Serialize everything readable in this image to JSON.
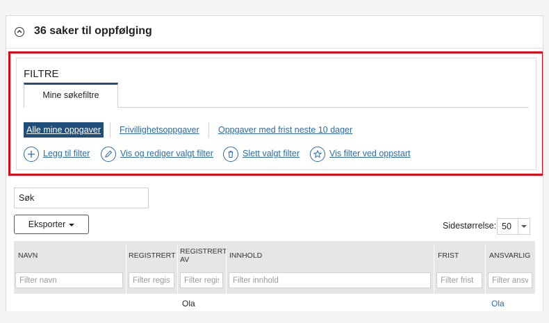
{
  "header": {
    "title": "36 saker til oppfølging"
  },
  "filters": {
    "heading": "FILTRE",
    "tab_label": "Mine søkefiltre",
    "quick_filters": [
      {
        "label": "Alle mine oppgaver",
        "active": true
      },
      {
        "label": "Frivillighetsoppgaver",
        "active": false
      },
      {
        "label": "Oppgaver med frist neste 10 dager",
        "active": false
      }
    ],
    "actions": [
      {
        "label": "Legg til filter",
        "icon": "plus-icon"
      },
      {
        "label": "Vis og rediger valgt filter",
        "icon": "pencil-icon"
      },
      {
        "label": "Slett valgt filter",
        "icon": "trash-icon"
      },
      {
        "label": "Vis filter ved oppstart",
        "icon": "star-icon"
      }
    ]
  },
  "toolbar": {
    "search_placeholder": "Søk",
    "export_label": "Eksporter",
    "page_size_label": "Sidestørrelse:",
    "page_size_value": "50"
  },
  "table": {
    "columns": [
      {
        "key": "navn",
        "label": "NAVN",
        "filter_placeholder": "Filter navn"
      },
      {
        "key": "registrert",
        "label": "REGISTRERT",
        "filter_placeholder": "Filter regist"
      },
      {
        "key": "registrert_av",
        "label": "REGISTRERT AV",
        "filter_placeholder": "Filter regis"
      },
      {
        "key": "innhold",
        "label": "INNHOLD",
        "filter_placeholder": "Filter innhold"
      },
      {
        "key": "frist",
        "label": "FRIST",
        "filter_placeholder": "Filter frist"
      },
      {
        "key": "ansvarlig",
        "label": "ANSVARLIG",
        "filter_placeholder": "Filter ansv"
      }
    ],
    "rows": [
      {
        "registrert_av": "Ola",
        "ansvarlig": "Ola"
      }
    ]
  },
  "colors": {
    "accent": "#1e4e79",
    "link": "#2d6ba6",
    "highlight_border": "#e30613"
  }
}
